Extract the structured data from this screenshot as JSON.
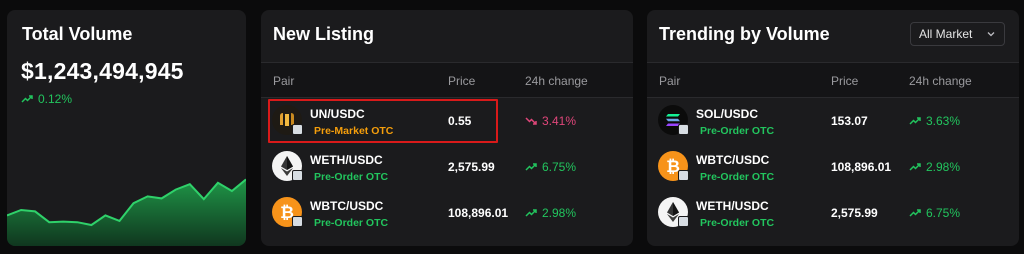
{
  "total_volume": {
    "title": "Total Volume",
    "value": "$1,243,494,945",
    "change": "0.12%",
    "trend": "up",
    "sparkline_shape": [
      0.58,
      0.5,
      0.52,
      0.68,
      0.67,
      0.68,
      0.72,
      0.58,
      0.66,
      0.4,
      0.3,
      0.33,
      0.2,
      0.12,
      0.34,
      0.1,
      0.22,
      0.05
    ],
    "accent_color": "#22c55e"
  },
  "new_listing": {
    "title": "New Listing",
    "columns": [
      "Pair",
      "Price",
      "24h change"
    ],
    "rows": [
      {
        "pair": "UN/USDC",
        "tag": "Pre-Market OTC",
        "tag_color": "orange",
        "price": "0.55",
        "change": "3.41%",
        "direction": "down",
        "icon": "un-coin-icon",
        "highlighted": true
      },
      {
        "pair": "WETH/USDC",
        "tag": "Pre-Order OTC",
        "tag_color": "green",
        "price": "2,575.99",
        "change": "6.75%",
        "direction": "up",
        "icon": "eth-coin-icon"
      },
      {
        "pair": "WBTC/USDC",
        "tag": "Pre-Order OTC",
        "tag_color": "green",
        "price": "108,896.01",
        "change": "2.98%",
        "direction": "up",
        "icon": "btc-coin-icon"
      }
    ]
  },
  "trending": {
    "title": "Trending by Volume",
    "market_select": "All Market",
    "columns": [
      "Pair",
      "Price",
      "24h change"
    ],
    "rows": [
      {
        "pair": "SOL/USDC",
        "tag": "Pre-Order OTC",
        "tag_color": "green",
        "price": "153.07",
        "change": "3.63%",
        "direction": "up",
        "icon": "sol-coin-icon"
      },
      {
        "pair": "WBTC/USDC",
        "tag": "Pre-Order OTC",
        "tag_color": "green",
        "price": "108,896.01",
        "change": "2.98%",
        "direction": "up",
        "icon": "btc-coin-icon"
      },
      {
        "pair": "WETH/USDC",
        "tag": "Pre-Order OTC",
        "tag_color": "green",
        "price": "2,575.99",
        "change": "6.75%",
        "direction": "up",
        "icon": "eth-coin-icon"
      }
    ]
  }
}
